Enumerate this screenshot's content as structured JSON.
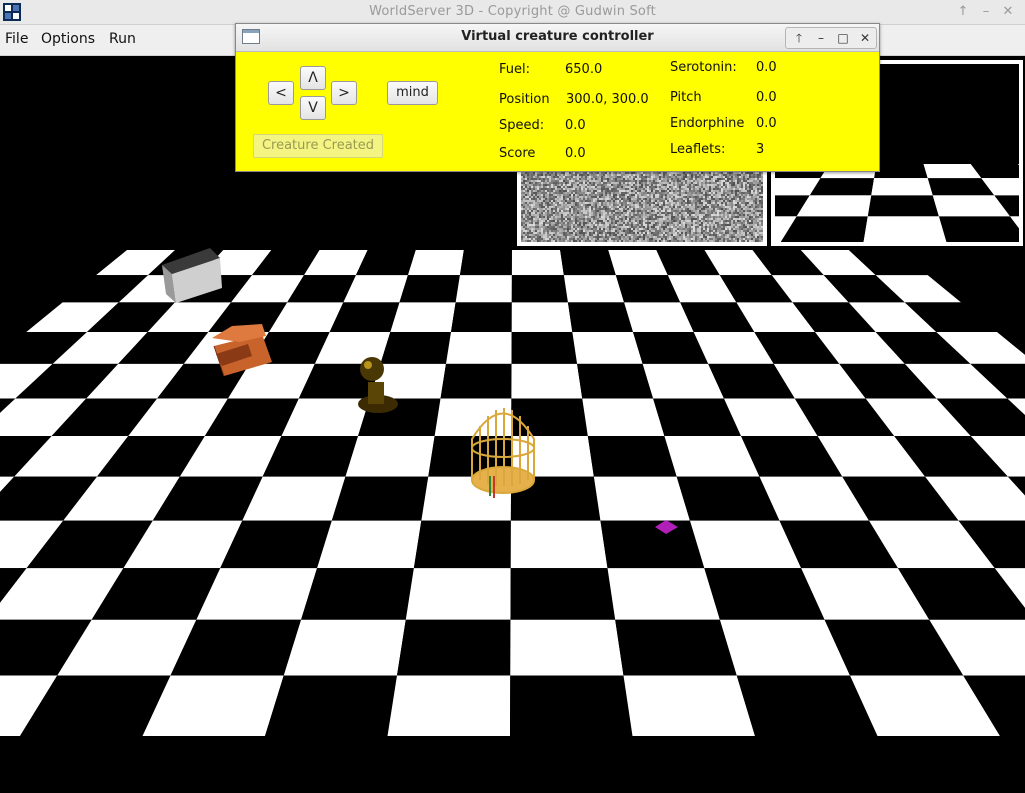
{
  "window": {
    "title": "WorldServer 3D - Copyright @ Gudwin Soft",
    "controls": {
      "up": "↑",
      "minimize": "–",
      "close": "✕"
    }
  },
  "menu": {
    "items": [
      "File",
      "Options",
      "Run"
    ]
  },
  "controller": {
    "title": "Virtual creature controller",
    "title_buttons": {
      "up": "🡑",
      "minimize": "–",
      "maximize": "□",
      "close": "✕"
    },
    "buttons": {
      "forward": "Λ",
      "left": "<",
      "right": ">",
      "backward": "V",
      "mind": "mind",
      "creature_created": "Creature Created"
    },
    "stats_left": [
      {
        "label": "Fuel:",
        "value": "650.0"
      },
      {
        "label": "Position",
        "value": "300.0, 300.0"
      },
      {
        "label": "Speed:",
        "value": "0.0"
      },
      {
        "label": "Score",
        "value": "0.0"
      }
    ],
    "stats_right": [
      {
        "label": "Serotonin:",
        "value": "0.0"
      },
      {
        "label": "Pitch",
        "value": "0.0"
      },
      {
        "label": "Endorphine",
        "value": "0.0"
      },
      {
        "label": "Leaflets:",
        "value": "3"
      }
    ],
    "background_color": "#ffff00"
  },
  "scene": {
    "objects": [
      "brick-cube",
      "treasure-chest",
      "creature-pawn",
      "golden-cage",
      "purple-jewel"
    ],
    "colors": {
      "floor_dark": "#000000",
      "floor_light": "#ffffff",
      "cage": "#d9a73a",
      "jewel": "#b01fb8",
      "chest": "#c8632c"
    }
  }
}
